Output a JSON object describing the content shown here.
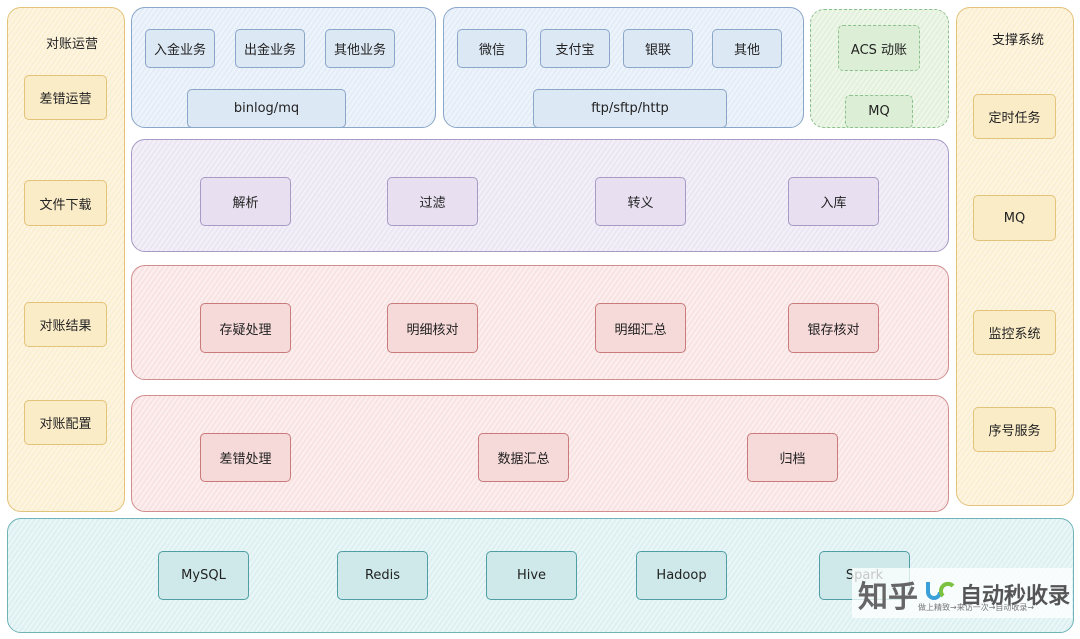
{
  "left_panel": {
    "title": "对账运营",
    "items": [
      "差错运营",
      "文件下载",
      "对账结果",
      "对账配置"
    ]
  },
  "right_panel": {
    "title": "支撑系统",
    "items": [
      "定时任务",
      "MQ",
      "监控系统",
      "序号服务"
    ]
  },
  "business_sources": {
    "items": [
      "入金业务",
      "出金业务",
      "其他业务"
    ],
    "channel": "binlog/mq"
  },
  "payment_channels": {
    "items": [
      "微信",
      "支付宝",
      "银联",
      "其他"
    ],
    "channel": "ftp/sftp/http"
  },
  "acs_group": {
    "items": [
      "ACS 动账",
      "MQ"
    ]
  },
  "processing_layer": {
    "items": [
      "解析",
      "过滤",
      "转义",
      "入库"
    ]
  },
  "reconciliation_layer": {
    "items": [
      "存疑处理",
      "明细核对",
      "明细汇总",
      "银存核对"
    ]
  },
  "post_layer": {
    "items": [
      "差错处理",
      "数据汇总",
      "归档"
    ]
  },
  "storage_layer": {
    "items": [
      "MySQL",
      "Redis",
      "Hive",
      "Hadoop",
      "Spark"
    ]
  },
  "watermark": {
    "brand": "知乎",
    "text": "自动秒收录",
    "slogan": "做上精致→来访一次→自动收录→"
  },
  "colors": {
    "yellow": "#e3c27a",
    "blue": "#8aa6c8",
    "green": "#8cc08c",
    "purple": "#a79ac4",
    "red": "#d28e8e",
    "teal": "#6fb3b8"
  }
}
